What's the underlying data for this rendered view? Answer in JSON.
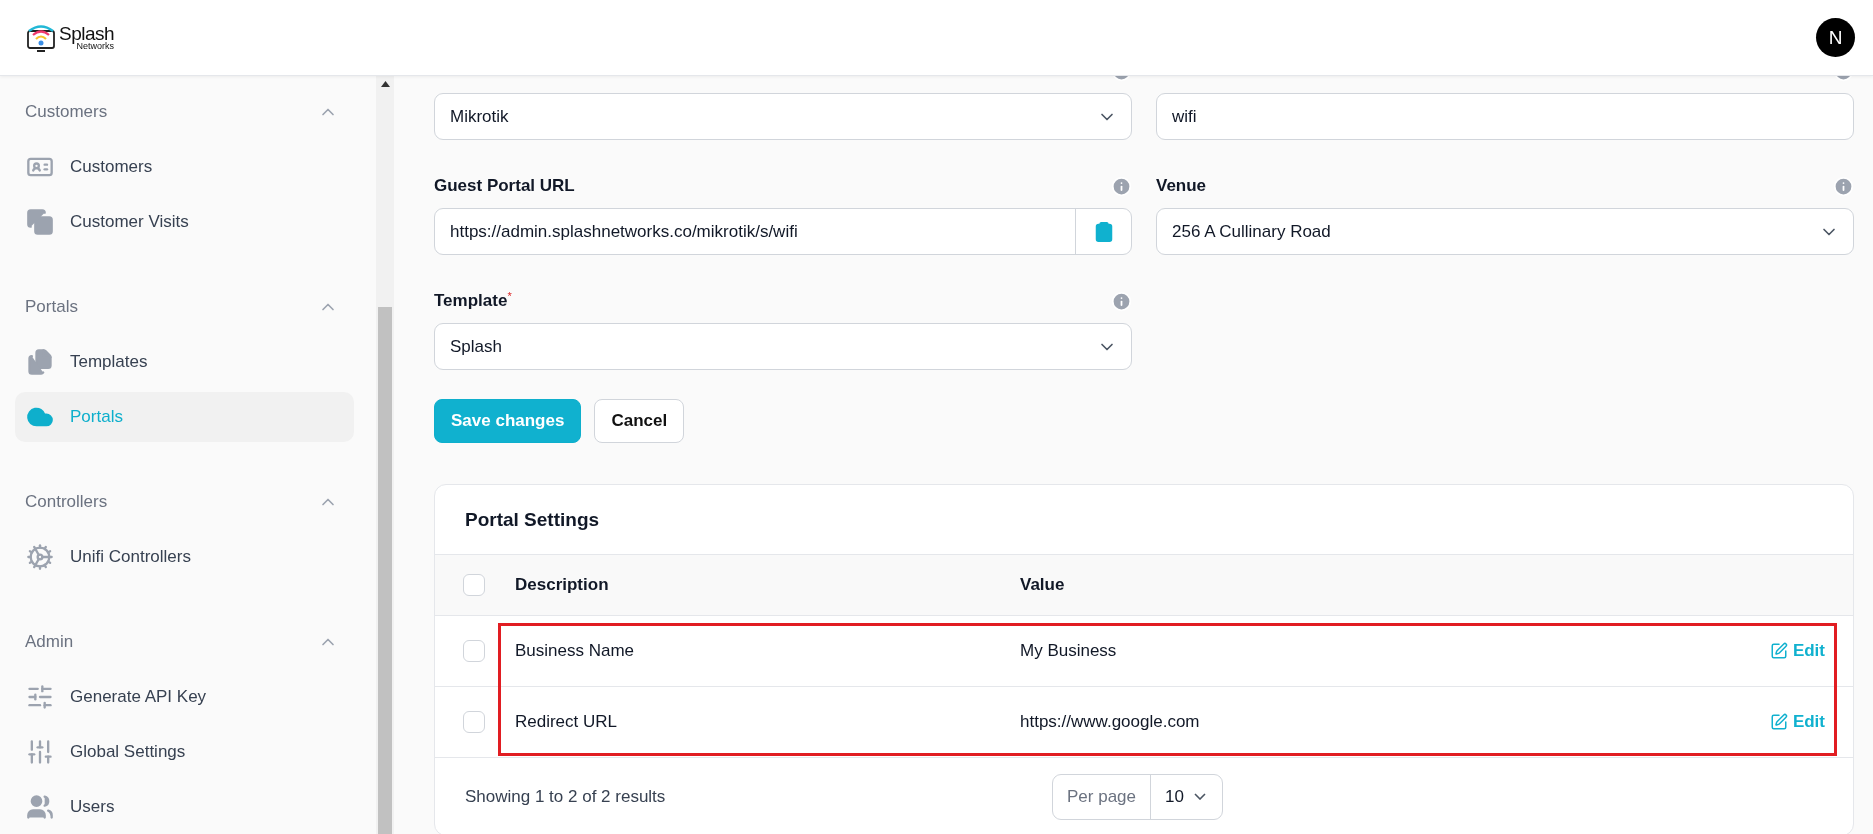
{
  "header": {
    "logo": {
      "name": "Splash",
      "tagline": "Networks"
    },
    "avatar": "N"
  },
  "sidebar": {
    "sections": [
      {
        "title": "Customers",
        "expanded": true,
        "items": [
          {
            "label": "Customers",
            "selected": false
          },
          {
            "label": "Customer Visits",
            "selected": false
          }
        ]
      },
      {
        "title": "Portals",
        "expanded": true,
        "items": [
          {
            "label": "Templates",
            "selected": false
          },
          {
            "label": "Portals",
            "selected": true
          }
        ]
      },
      {
        "title": "Controllers",
        "expanded": true,
        "items": [
          {
            "label": "Unifi Controllers",
            "selected": false
          }
        ]
      },
      {
        "title": "Admin",
        "expanded": true,
        "items": [
          {
            "label": "Generate API Key",
            "selected": false
          },
          {
            "label": "Global Settings",
            "selected": false
          },
          {
            "label": "Users",
            "selected": false
          }
        ]
      }
    ]
  },
  "form": {
    "fields": [
      {
        "kind": "select",
        "value": "Mikrotik"
      },
      {
        "kind": "text",
        "value": "wifi"
      },
      {
        "label": "Guest Portal URL",
        "kind": "copy",
        "value": "https://admin.splashnetworks.co/mikrotik/s/wifi"
      },
      {
        "label": "Venue",
        "kind": "select",
        "value": "256 A Cullinary Road"
      },
      {
        "label": "Template",
        "required_mark": "*",
        "kind": "select",
        "value": "Splash"
      }
    ],
    "buttons": [
      {
        "label": "Save changes",
        "kind": "primary"
      },
      {
        "label": "Cancel",
        "kind": "secondary"
      }
    ]
  },
  "table": {
    "title": "Portal Settings",
    "all_checked": false,
    "columns": [
      "Description",
      "Value"
    ],
    "annotation_frame": true,
    "rows": [
      {
        "description": "Business Name",
        "value": "My Business",
        "action": "Edit",
        "checked": false
      },
      {
        "description": "Redirect URL",
        "value": "https://www.google.com",
        "action": "Edit",
        "checked": false
      }
    ],
    "footer": {
      "summary": "Showing 1 to 2 of 2 results",
      "per_page_label": "Per page",
      "per_page": "10"
    }
  }
}
